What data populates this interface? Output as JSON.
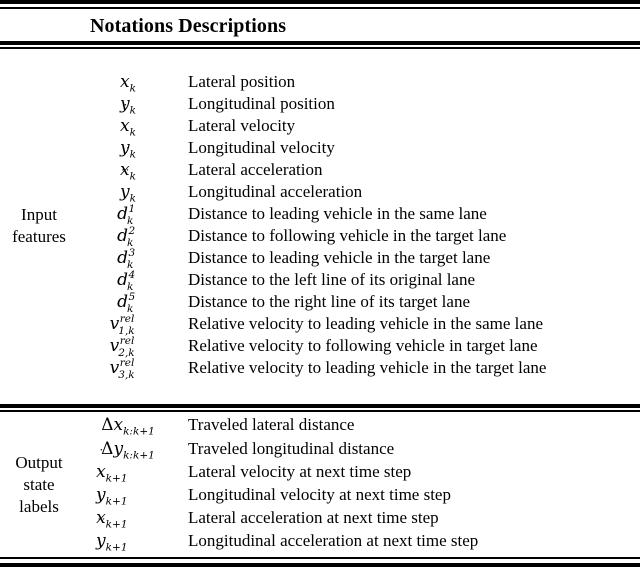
{
  "table": {
    "header": {
      "title": "Notations Descriptions"
    },
    "sections": [
      {
        "label_lines": [
          "Input",
          "features"
        ],
        "rows": [
          {
            "notation_text": "x_k",
            "description": "Lateral position"
          },
          {
            "notation_text": "y_k",
            "description": "Longitudinal position"
          },
          {
            "notation_text": "xdot_k",
            "description": "Lateral velocity"
          },
          {
            "notation_text": "ydot_k",
            "description": "Longitudinal velocity"
          },
          {
            "notation_text": "xddot_k",
            "description": "Lateral acceleration"
          },
          {
            "notation_text": "yddot_k",
            "description": "Longitudinal acceleration"
          },
          {
            "notation_text": "d^1_k",
            "description": "Distance to leading vehicle in the same lane"
          },
          {
            "notation_text": "d^2_k",
            "description": "Distance to following vehicle in the target lane"
          },
          {
            "notation_text": "d^3_k",
            "description": "Distance to leading vehicle in the target lane"
          },
          {
            "notation_text": "d^4_k",
            "description": "Distance to the left line of its original lane"
          },
          {
            "notation_text": "d^5_k",
            "description": "Distance to the right line of its target lane"
          },
          {
            "notation_text": "v^rel_1,k",
            "description": "Relative velocity to leading vehicle in the same lane"
          },
          {
            "notation_text": "v^rel_2,k",
            "description": "Relative velocity to following vehicle in target lane"
          },
          {
            "notation_text": "v^rel_3,k",
            "description": "Relative velocity to leading vehicle in the target lane"
          }
        ]
      },
      {
        "label_lines": [
          "Output",
          "state",
          "labels"
        ],
        "rows": [
          {
            "notation_text": "delta_x_k:k+1",
            "description": "Traveled lateral distance"
          },
          {
            "notation_text": "delta_y_k:k+1",
            "description": "Traveled longitudinal distance"
          },
          {
            "notation_text": "xdot_k+1",
            "description": "Lateral velocity at next time step"
          },
          {
            "notation_text": "ydot_k+1",
            "description": "Longitudinal velocity at next time step"
          },
          {
            "notation_text": "xddot_k+1",
            "description": "Lateral acceleration at next time step"
          },
          {
            "notation_text": "yddot_k+1",
            "description": "Longitudinal acceleration at next time step"
          }
        ]
      }
    ],
    "colors": {
      "text": "#000000",
      "background": "#ffffff",
      "rule": "#000000"
    }
  }
}
